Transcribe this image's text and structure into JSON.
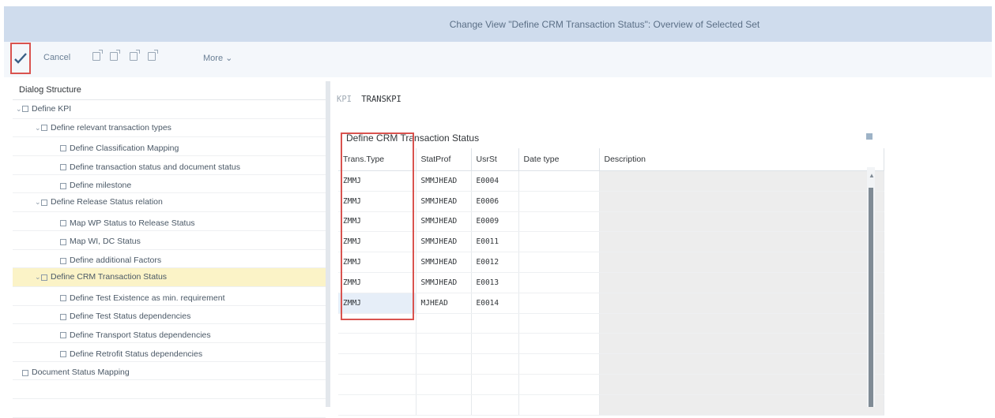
{
  "title": "Change View \"Define CRM Transaction Status\": Overview of Selected Set",
  "toolbar": {
    "cancel_label": "Cancel",
    "more_label": "More"
  },
  "dialog_structure": {
    "heading": "Dialog Structure",
    "items": [
      {
        "label": "Define KPI",
        "level": 0,
        "expanded": true
      },
      {
        "label": "Define relevant transaction types",
        "level": 1,
        "expanded": true
      },
      {
        "label": "Define Classification Mapping",
        "level": 2
      },
      {
        "label": "Define transaction status and document status",
        "level": 2
      },
      {
        "label": "Define milestone",
        "level": 2
      },
      {
        "label": "Define Release Status relation",
        "level": 1,
        "expanded": true
      },
      {
        "label": "Map WP Status to Release Status",
        "level": 2
      },
      {
        "label": "Map WI, DC Status",
        "level": 2
      },
      {
        "label": "Define additional Factors",
        "level": 2
      },
      {
        "label": "Define CRM Transaction Status",
        "level": 1,
        "expanded": true,
        "selected": true
      },
      {
        "label": "Define Test Existence as min. requirement",
        "level": 2
      },
      {
        "label": "Define Test Status dependencies",
        "level": 2
      },
      {
        "label": "Define Transport Status dependencies",
        "level": 2
      },
      {
        "label": "Define Retrofit Status dependencies",
        "level": 2
      },
      {
        "label": "Document Status Mapping",
        "level": 0
      }
    ]
  },
  "kpi": {
    "label": "KPI",
    "value": "TRANSKPI"
  },
  "section": {
    "title": "Define CRM Transaction Status"
  },
  "table": {
    "columns": [
      "Trans.Type",
      "StatProf",
      "UsrSt",
      "Date type",
      "Description"
    ],
    "rows": [
      {
        "trans_type": "ZMMJ",
        "stat_prof": "SMMJHEAD",
        "usr_st": "E0004",
        "date_type": "",
        "description": ""
      },
      {
        "trans_type": "ZMMJ",
        "stat_prof": "SMMJHEAD",
        "usr_st": "E0006",
        "date_type": "",
        "description": ""
      },
      {
        "trans_type": "ZMMJ",
        "stat_prof": "SMMJHEAD",
        "usr_st": "E0009",
        "date_type": "",
        "description": ""
      },
      {
        "trans_type": "ZMMJ",
        "stat_prof": "SMMJHEAD",
        "usr_st": "E0011",
        "date_type": "",
        "description": ""
      },
      {
        "trans_type": "ZMMJ",
        "stat_prof": "SMMJHEAD",
        "usr_st": "E0012",
        "date_type": "",
        "description": ""
      },
      {
        "trans_type": "ZMMJ",
        "stat_prof": "SMMJHEAD",
        "usr_st": "E0013",
        "date_type": "",
        "description": ""
      },
      {
        "trans_type": "ZMMJ",
        "stat_prof": "MJHEAD",
        "usr_st": "E0014",
        "date_type": "",
        "description": "",
        "selected": true
      }
    ]
  },
  "colors": {
    "title_bar": "#cfdced",
    "selected_tree_row": "#fbf3c7",
    "highlight_box": "#d9534f",
    "description_column": "#ededed"
  }
}
